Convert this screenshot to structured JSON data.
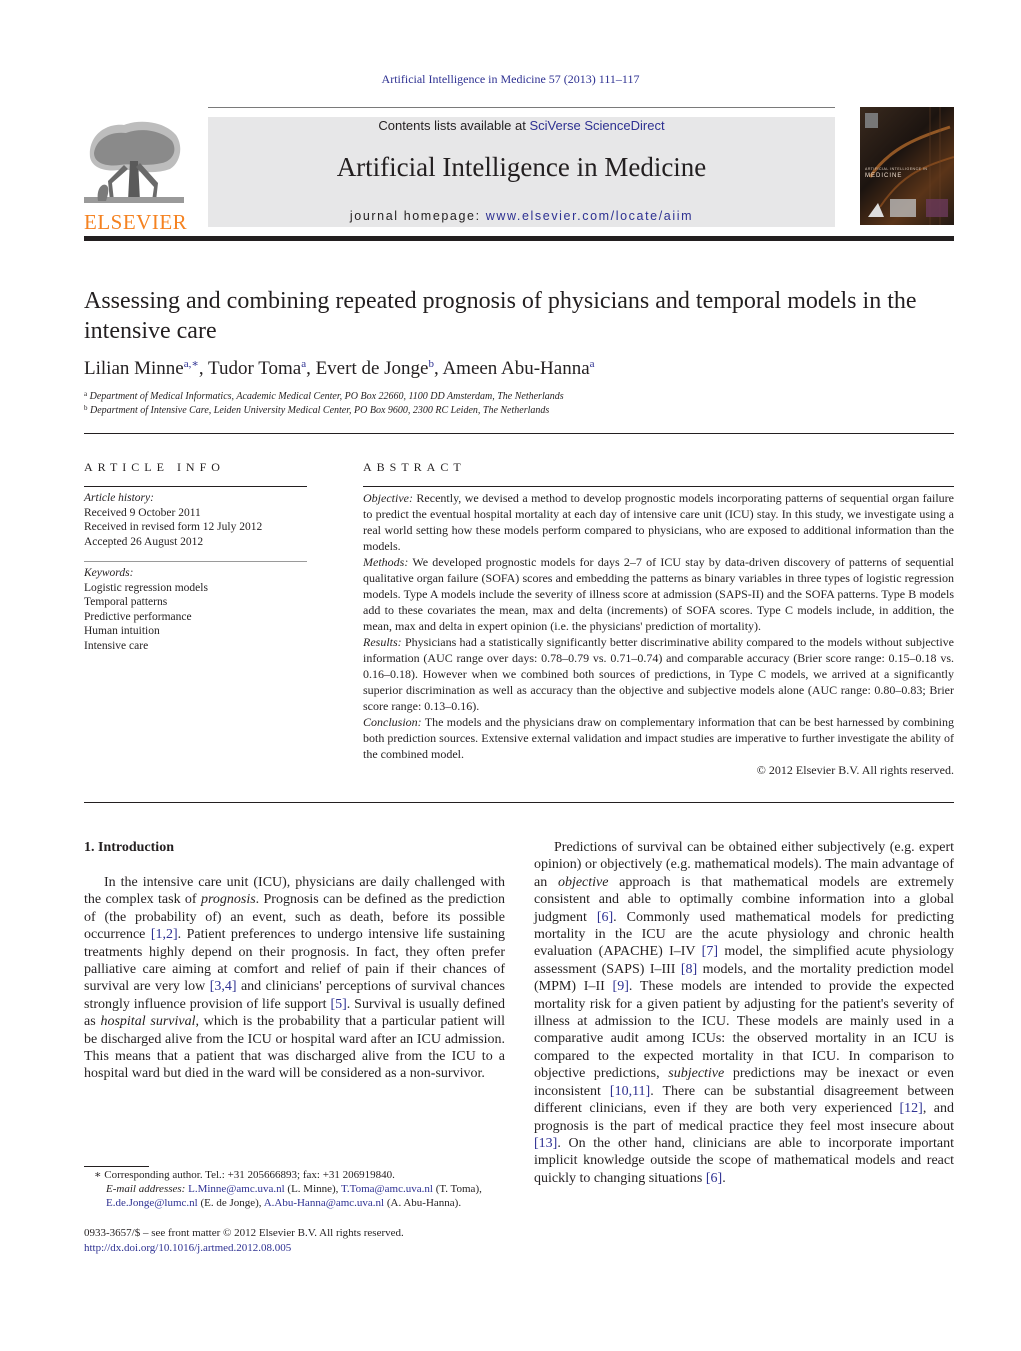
{
  "header": {
    "citation": "Artificial Intelligence in Medicine 57 (2013) 111–117",
    "contents_prefix": "Contents lists available at ",
    "contents_link": "SciVerse ScienceDirect",
    "journal_title": "Artificial Intelligence in Medicine",
    "homepage_prefix": "journal homepage: ",
    "homepage_link": "www.elsevier.com/locate/aiim",
    "publisher_logo_text": "ELSEVIER",
    "cover_title_line1": "ARTIFICIAL INTELLIGENCE IN",
    "cover_title_line2": "MEDICINE",
    "colors": {
      "link": "#2e3192",
      "elsevier_orange": "#f58220",
      "banner_bg": "#e7e7e8"
    }
  },
  "article": {
    "title": "Assessing and combining repeated prognosis of physicians and temporal models in the intensive care",
    "authors": [
      {
        "name": "Lilian Minne",
        "sup": "a,∗",
        "sep": ", "
      },
      {
        "name": "Tudor Toma",
        "sup": "a",
        "sep": ", "
      },
      {
        "name": "Evert de Jonge",
        "sup": "b",
        "sep": ", "
      },
      {
        "name": "Ameen Abu-Hanna",
        "sup": "a",
        "sep": ""
      }
    ],
    "affiliations": [
      {
        "mark": "a",
        "text": "Department of Medical Informatics, Academic Medical Center, PO Box 22660, 1100 DD Amsterdam, The Netherlands"
      },
      {
        "mark": "b",
        "text": "Department of Intensive Care, Leiden University Medical Center, PO Box 9600, 2300 RC Leiden, The Netherlands"
      }
    ]
  },
  "article_info": {
    "heading": "ARTICLE INFO",
    "history_label": "Article history:",
    "history": [
      "Received 9 October 2011",
      "Received in revised form 12 July 2012",
      "Accepted 26 August 2012"
    ],
    "keywords_label": "Keywords:",
    "keywords": [
      "Logistic regression models",
      "Temporal patterns",
      "Predictive performance",
      "Human intuition",
      "Intensive care"
    ]
  },
  "abstract": {
    "heading": "ABSTRACT",
    "sections": [
      {
        "label": "Objective:",
        "text": " Recently, we devised a method to develop prognostic models incorporating patterns of sequential organ failure to predict the eventual hospital mortality at each day of intensive care unit (ICU) stay. In this study, we investigate using a real world setting how these models perform compared to physicians, who are exposed to additional information than the models."
      },
      {
        "label": "Methods:",
        "text": " We developed prognostic models for days 2–7 of ICU stay by data-driven discovery of patterns of sequential qualitative organ failure (SOFA) scores and embedding the patterns as binary variables in three types of logistic regression models. Type A models include the severity of illness score at admission (SAPS-II) and the SOFA patterns. Type B models add to these covariates the mean, max and delta (increments) of SOFA scores. Type C models include, in addition, the mean, max and delta in expert opinion (i.e. the physicians' prediction of mortality)."
      },
      {
        "label": "Results:",
        "text": " Physicians had a statistically significantly better discriminative ability compared to the models without subjective information (AUC range over days: 0.78–0.79 vs. 0.71–0.74) and comparable accuracy (Brier score range: 0.15–0.18 vs. 0.16–0.18). However when we combined both sources of predictions, in Type C models, we arrived at a significantly superior discrimination as well as accuracy than the objective and subjective models alone (AUC range: 0.80–0.83; Brier score range: 0.13–0.16)."
      },
      {
        "label": "Conclusion:",
        "text": " The models and the physicians draw on complementary information that can be best harnessed by combining both prediction sources. Extensive external validation and impact studies are imperative to further investigate the ability of the combined model."
      }
    ],
    "copyright": "© 2012 Elsevier B.V. All rights reserved."
  },
  "introduction": {
    "heading": "1.  Introduction",
    "left_para": [
      {
        "t": "In the intensive care unit (ICU), physicians are daily challenged with the complex task of "
      },
      {
        "i": "prognosis"
      },
      {
        "t": ". Prognosis can be defined as the prediction of (the probability of) an event, such as death, before its possible occurrence "
      },
      {
        "ref": "[1,2]"
      },
      {
        "t": ". Patient preferences to undergo intensive life sustaining treatments highly depend on their prognosis. In fact, they often prefer palliative care aiming at comfort and relief of pain if their chances of survival are very low "
      },
      {
        "ref": "[3,4]"
      },
      {
        "t": " and clinicians' perceptions of survival chances strongly influence provision of life support "
      },
      {
        "ref": "[5]"
      },
      {
        "t": ". Survival is usually defined as "
      },
      {
        "i": "hospital survival"
      },
      {
        "t": ", which is the probability that a particular patient will be discharged alive from the ICU or hospital ward after an ICU admission. This means that a patient that was discharged alive from the ICU to a hospital ward but died in the ward will be considered as a non-survivor."
      }
    ],
    "right_para": [
      {
        "t": "Predictions of survival can be obtained either subjectively (e.g. expert opinion) or objectively (e.g. mathematical models). The main advantage of an "
      },
      {
        "i": "objective"
      },
      {
        "t": " approach is that mathematical models are extremely consistent and able to optimally combine information into a global judgment "
      },
      {
        "ref": "[6]"
      },
      {
        "t": ". Commonly used mathematical models for predicting mortality in the ICU are the acute physiology and chronic health evaluation (APACHE) I–IV "
      },
      {
        "ref": "[7]"
      },
      {
        "t": " model, the simplified acute physiology assessment (SAPS) I–III "
      },
      {
        "ref": "[8]"
      },
      {
        "t": " models, and the mortality prediction model (MPM) I–II "
      },
      {
        "ref": "[9]"
      },
      {
        "t": ". These models are intended to provide the expected mortality risk for a given patient by adjusting for the patient's severity of illness at admission to the ICU. These models are mainly used in a comparative audit among ICUs: the observed mortality in an ICU is compared to the expected mortality in that ICU. In comparison to objective predictions, "
      },
      {
        "i": "subjective"
      },
      {
        "t": " predictions may be inexact or even inconsistent "
      },
      {
        "ref": "[10,11]"
      },
      {
        "t": ". There can be substantial disagreement between different clinicians, even if they are both very experienced "
      },
      {
        "ref": "[12]"
      },
      {
        "t": ", and prognosis is the part of medical practice they feel most insecure about "
      },
      {
        "ref": "[13]"
      },
      {
        "t": ". On the other hand, clinicians are able to incorporate important implicit knowledge outside the scope of mathematical models and react quickly to changing situations "
      },
      {
        "ref": "[6]"
      },
      {
        "t": "."
      }
    ]
  },
  "footnotes": {
    "corresponding": "∗  Corresponding author. Tel.: +31 205666893; fax: +31 206919840.",
    "email_label": "E-mail addresses:",
    "emails": [
      {
        "addr": "L.Minne@amc.uva.nl",
        "who": " (L. Minne), "
      },
      {
        "addr": "T.Toma@amc.uva.nl",
        "who": " (T. Toma), "
      },
      {
        "addr": "E.de.Jonge@lumc.nl",
        "who": " (E. de Jonge), "
      },
      {
        "addr": "A.Abu-Hanna@amc.uva.nl",
        "who": " (A. Abu-Hanna)."
      }
    ],
    "issn_line": "0933-3657/$ – see front matter © 2012 Elsevier B.V. All rights reserved.",
    "doi_link": "http://dx.doi.org/10.1016/j.artmed.2012.08.005"
  }
}
